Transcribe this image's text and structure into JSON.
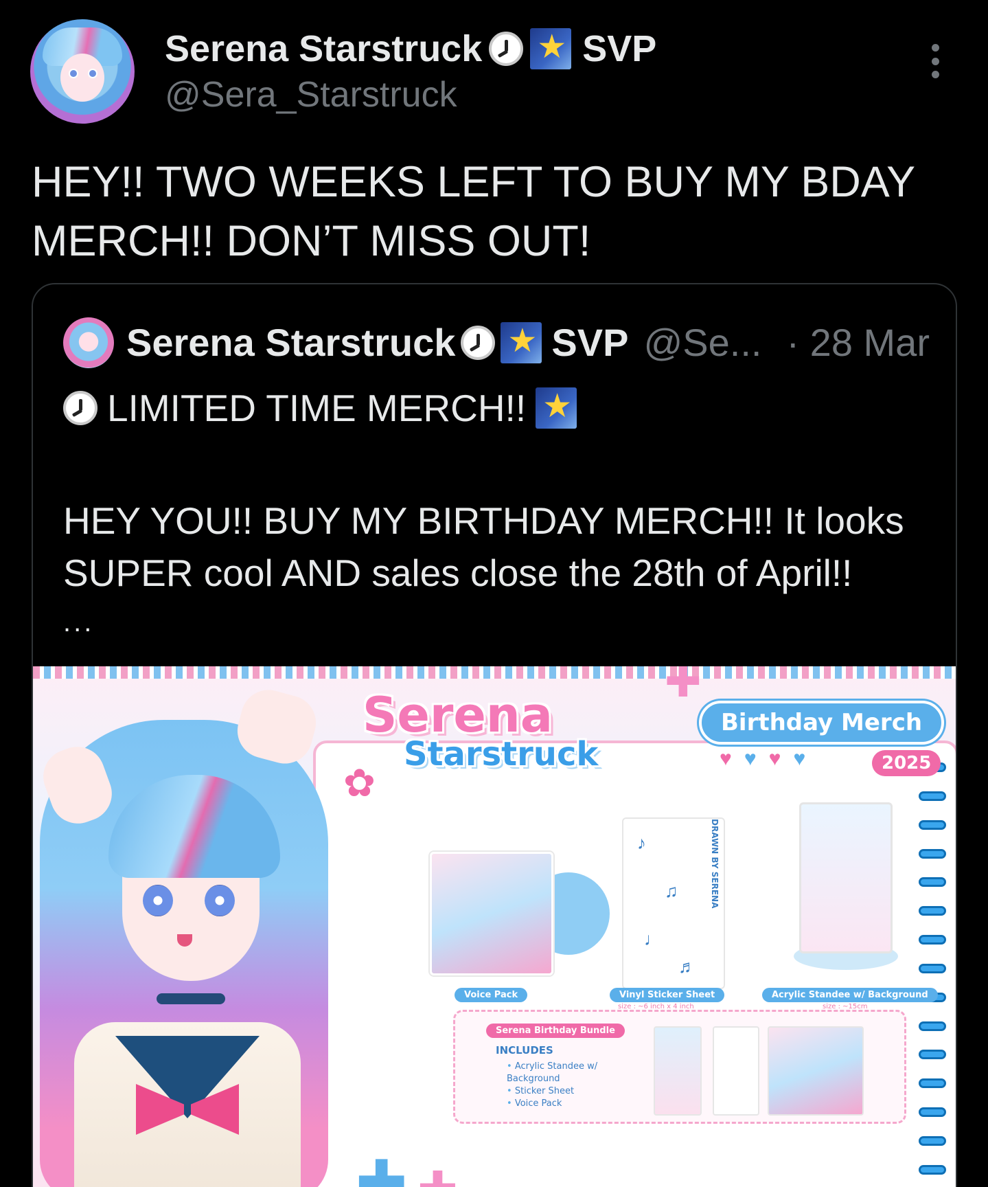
{
  "post": {
    "author_name": "Serena Starstruck",
    "author_tag": "SVP",
    "handle": "@Sera_Starstruck",
    "text": "HEY!! TWO WEEKS LEFT TO BUY MY BDAY MERCH!! DON’T MISS OUT!",
    "icons": [
      "clock-emoji",
      "shooting-star-emoji",
      "more-options-icon"
    ]
  },
  "quoted_post": {
    "author_name": "Serena Starstruck",
    "author_tag": "SVP",
    "handle": "@Se...",
    "date": "· 28 Mar",
    "headline": "LIMITED TIME MERCH!!",
    "body": "HEY YOU!! BUY MY BIRTHDAY MERCH!! It looks SUPER cool AND sales close the 28th of April!!",
    "ellipsis": "..."
  },
  "merch_image": {
    "title_line1": "Serena",
    "title_line2": "Starstruck",
    "badge": "Birthday Merch",
    "year": "2025",
    "drawn_by": "DRAWN BY SERENA",
    "products": [
      {
        "name": "Voice Pack",
        "size": ""
      },
      {
        "name": "Vinyl Sticker Sheet",
        "size": "size : ~6 inch x 4 inch"
      },
      {
        "name": "Acrylic Standee w/ Background",
        "size": "size : ~15cm"
      }
    ],
    "bundle": {
      "name": "Serena Birthday Bundle",
      "includes_label": "INCLUDES",
      "items": [
        "Acrylic Standee w/ Background",
        "Sticker Sheet",
        "Voice Pack"
      ]
    },
    "accent_colors": {
      "pink": "#f06aa8",
      "blue": "#5aafea"
    }
  }
}
